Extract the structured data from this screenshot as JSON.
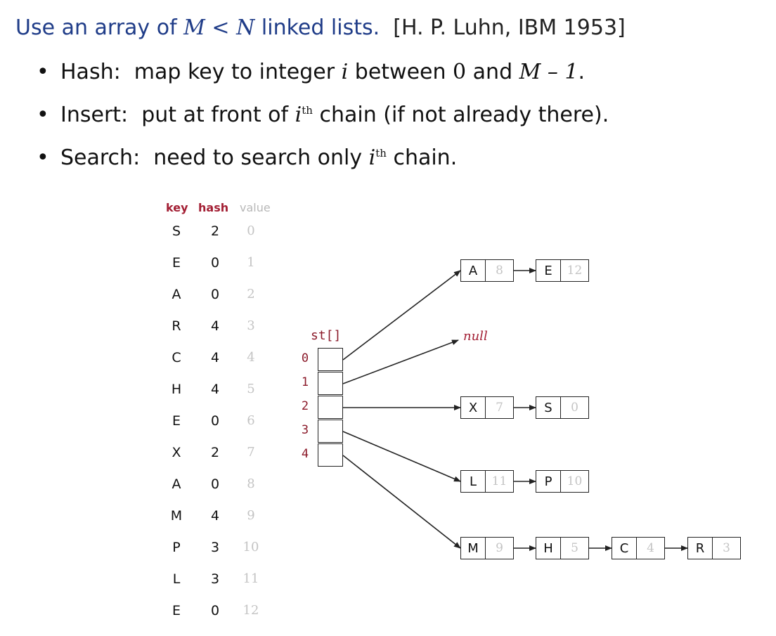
{
  "slide": {
    "headline": {
      "prefix": "Use an array of ",
      "math": "M < N",
      "suffix": " linked lists.",
      "citation": "[H. P. Luhn, IBM 1953]"
    },
    "bullets": [
      {
        "term": "Hash:",
        "before": "map key to integer ",
        "var": "i",
        "mid": " between ",
        "zero": "0",
        "and": " and ",
        "bound": "M – 1",
        "end": "."
      },
      {
        "term": "Insert:",
        "before": "put at front of ",
        "var": "i",
        "sup": "th",
        "after": " chain (if not already there)."
      },
      {
        "term": "Search:",
        "before": "need to search only ",
        "var": "i",
        "sup": "th",
        "after": " chain."
      }
    ]
  },
  "table": {
    "headers": {
      "key": "key",
      "hash": "hash",
      "value": "value"
    },
    "rows": [
      {
        "key": "S",
        "hash": "2",
        "value": "0"
      },
      {
        "key": "E",
        "hash": "0",
        "value": "1"
      },
      {
        "key": "A",
        "hash": "0",
        "value": "2"
      },
      {
        "key": "R",
        "hash": "4",
        "value": "3"
      },
      {
        "key": "C",
        "hash": "4",
        "value": "4"
      },
      {
        "key": "H",
        "hash": "4",
        "value": "5"
      },
      {
        "key": "E",
        "hash": "0",
        "value": "6"
      },
      {
        "key": "X",
        "hash": "2",
        "value": "7"
      },
      {
        "key": "A",
        "hash": "0",
        "value": "8"
      },
      {
        "key": "M",
        "hash": "4",
        "value": "9"
      },
      {
        "key": "P",
        "hash": "3",
        "value": "10"
      },
      {
        "key": "L",
        "hash": "3",
        "value": "11"
      },
      {
        "key": "E",
        "hash": "0",
        "value": "12"
      }
    ]
  },
  "array": {
    "label": "st[]",
    "indices": [
      "0",
      "1",
      "2",
      "3",
      "4"
    ],
    "null_label": "null"
  },
  "chains": [
    [
      {
        "key": "A",
        "value": "8"
      },
      {
        "key": "E",
        "value": "12"
      }
    ],
    [],
    [
      {
        "key": "X",
        "value": "7"
      },
      {
        "key": "S",
        "value": "0"
      }
    ],
    [
      {
        "key": "L",
        "value": "11"
      },
      {
        "key": "P",
        "value": "10"
      }
    ],
    [
      {
        "key": "M",
        "value": "9"
      },
      {
        "key": "H",
        "value": "5"
      },
      {
        "key": "C",
        "value": "4"
      },
      {
        "key": "R",
        "value": "3"
      }
    ]
  ],
  "colors": {
    "headline": "#1f3c88",
    "accent": "#a31f34",
    "muted_value": "#c4c4c4",
    "line": "#222222"
  }
}
